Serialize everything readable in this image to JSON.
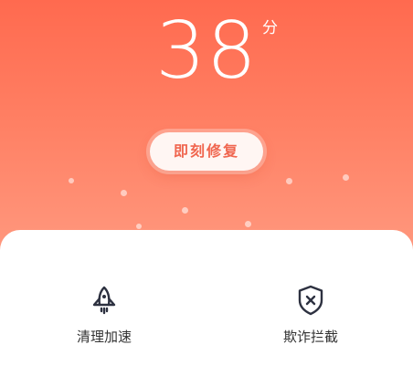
{
  "score": {
    "value": "38",
    "unit": "分"
  },
  "repair_button": {
    "label": "即刻修复"
  },
  "features": [
    {
      "label": "清理加速",
      "icon": "rocket-icon"
    },
    {
      "label": "欺诈拦截",
      "icon": "shield-x-icon"
    }
  ],
  "colors": {
    "header_top": "#ff6a4f",
    "header_bottom": "#ff9a80",
    "button_text": "#f0664f",
    "icon": "#2d3140"
  }
}
